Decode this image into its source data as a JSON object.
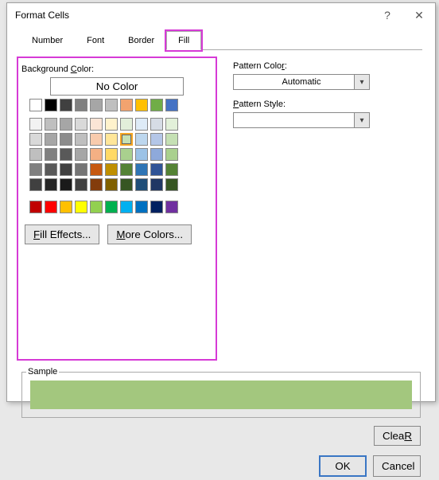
{
  "dialog": {
    "title": "Format Cells"
  },
  "tabs": {
    "number": "Number",
    "font": "Font",
    "border": "Border",
    "fill": "Fill"
  },
  "left": {
    "bgcolor_label_pre": "Background ",
    "bgcolor_label_ul": "C",
    "bgcolor_label_post": "olor:",
    "nocolor": "No Color",
    "fill_effects_ul": "F",
    "fill_effects_rest": "ill Effects...",
    "more_colors_ul": "M",
    "more_colors_rest": "ore Colors..."
  },
  "right": {
    "pattern_color_pre": "Pattern Colo",
    "pattern_color_ul": "r",
    "pattern_color_post": ":",
    "pattern_color_value": "Automatic",
    "pattern_style_pre": "",
    "pattern_style_ul": "P",
    "pattern_style_post": "attern Style:",
    "pattern_style_value": ""
  },
  "sample": {
    "label": "Sample",
    "color": "#a3c77e"
  },
  "footer": {
    "clear_ul": "R",
    "clear_pre": "Clea",
    "clear_post": "",
    "ok": "OK",
    "cancel": "Cancel"
  },
  "theme_row": [
    "#ffffff",
    "#000000",
    "#404040",
    "#808080",
    "#a6a6a6",
    "#bfbfbf",
    "#f2a36f",
    "#ffc000",
    "#70ad47",
    "#4472c4"
  ],
  "theme_grid": [
    [
      "#f2f2f2",
      "#bfbfbf",
      "#a6a6a6",
      "#d9d9d9",
      "#fbe5d6",
      "#fff2cc",
      "#e2efda",
      "#deebf7",
      "#d6dce5",
      "#e2f0d9"
    ],
    [
      "#d9d9d9",
      "#a6a6a6",
      "#8c8c8c",
      "#bfbfbf",
      "#f8cbad",
      "#ffe699",
      "#c6e0b4",
      "#bdd7ee",
      "#b4c6e7",
      "#c5e0b4"
    ],
    [
      "#bfbfbf",
      "#808080",
      "#595959",
      "#a6a6a6",
      "#f4b084",
      "#ffd966",
      "#a9d08e",
      "#9bc2e6",
      "#8ea9db",
      "#a9d08e"
    ],
    [
      "#808080",
      "#595959",
      "#404040",
      "#757575",
      "#c65911",
      "#bf8f00",
      "#548235",
      "#2f75b5",
      "#305496",
      "#548235"
    ],
    [
      "#404040",
      "#262626",
      "#1a1a1a",
      "#404040",
      "#833c0c",
      "#806000",
      "#375623",
      "#1f4e78",
      "#203764",
      "#375623"
    ]
  ],
  "standard": [
    "#c00000",
    "#ff0000",
    "#ffc000",
    "#ffff00",
    "#92d050",
    "#00b050",
    "#00b0f0",
    "#0070c0",
    "#002060",
    "#7030a0"
  ],
  "selected_theme": "#c6e0b4"
}
